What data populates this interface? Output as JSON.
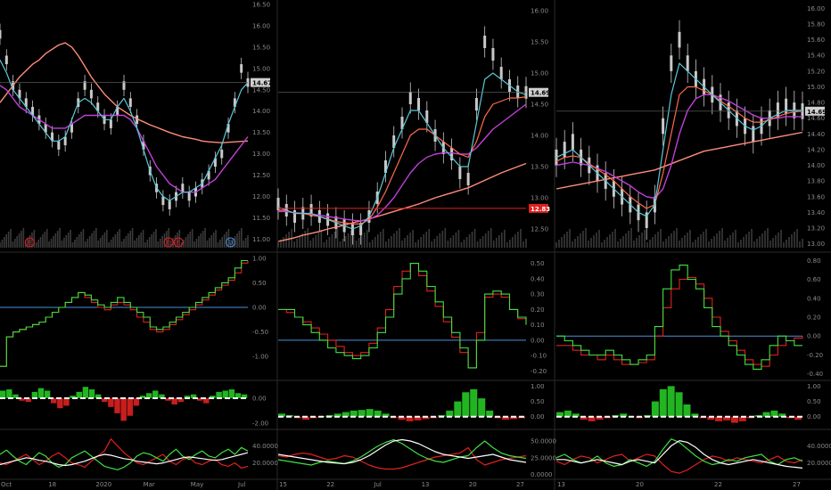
{
  "colors": {
    "background": "#000000",
    "divider": "#2a2a2a",
    "axis_text": "#8a8a8a",
    "candle": "#c8c8c8",
    "volume": "#3a3a3a",
    "ma_cyan": "#5bc8d8",
    "ma_orange": "#ff6b4a",
    "ma_magenta": "#c040d8",
    "ma_salmon": "#ff8c78",
    "line_red": "#e02020",
    "line_green": "#40e040",
    "line_blue": "#4a90d9",
    "line_white": "#ffffff",
    "hist_green": "#22b522",
    "hist_red": "#c81e1e",
    "price_label_bg": "#d0d0d0",
    "price_label_red": "#e02020"
  },
  "chart_data": [
    {
      "type": "line",
      "panel": "left-price",
      "timeframe_ticks": [
        "Oct",
        "18",
        "2020",
        "Mar",
        "May",
        "Jul"
      ],
      "y_ticks": [
        "16.50",
        "16.00",
        "15.50",
        "15.00",
        "14.50",
        "14.00",
        "13.50",
        "13.00",
        "12.50",
        "12.00",
        "11.50",
        "11.00"
      ],
      "ylim": [
        10.8,
        16.5
      ],
      "last_price_label": "14.67",
      "last_price": 14.67,
      "event_markers": [
        "E",
        "E",
        "E",
        "D"
      ],
      "price": [
        15.8,
        15.2,
        14.6,
        14.4,
        14.2,
        14.0,
        13.8,
        13.6,
        13.4,
        13.2,
        13.3,
        13.6,
        14.2,
        14.6,
        14.4,
        14.1,
        13.8,
        13.7,
        14.0,
        14.6,
        14.2,
        13.8,
        13.2,
        12.6,
        12.2,
        11.9,
        11.8,
        12.0,
        12.2,
        12.0,
        12.1,
        12.3,
        12.5,
        12.8,
        13.0,
        13.6,
        14.2,
        15.0,
        14.67
      ],
      "ma_cyan": [
        15.2,
        14.9,
        14.5,
        14.3,
        14.1,
        13.9,
        13.7,
        13.5,
        13.3,
        13.3,
        13.4,
        13.8,
        14.2,
        14.3,
        14.2,
        14.0,
        13.8,
        13.8,
        14.1,
        14.3,
        14.0,
        13.6,
        13.1,
        12.6,
        12.2,
        12.0,
        11.9,
        12.0,
        12.1,
        12.1,
        12.2,
        12.3,
        12.6,
        12.9,
        13.2,
        13.7,
        14.1,
        14.5,
        14.67
      ],
      "ma_magenta": [
        14.6,
        14.5,
        14.3,
        14.1,
        14.0,
        13.9,
        13.8,
        13.7,
        13.6,
        13.6,
        13.6,
        13.7,
        13.8,
        13.9,
        13.9,
        13.9,
        13.9,
        13.9,
        13.9,
        13.9,
        13.8,
        13.6,
        13.3,
        13.0,
        12.7,
        12.5,
        12.3,
        12.2,
        12.1,
        12.1,
        12.1,
        12.2,
        12.3,
        12.4,
        12.6,
        12.8,
        13.0,
        13.2,
        13.4
      ],
      "ma_salmon": [
        14.2,
        14.4,
        14.6,
        14.8,
        14.95,
        15.1,
        15.2,
        15.35,
        15.45,
        15.55,
        15.6,
        15.5,
        15.3,
        15.05,
        14.8,
        14.6,
        14.4,
        14.25,
        14.1,
        14.0,
        13.9,
        13.82,
        13.75,
        13.68,
        13.62,
        13.56,
        13.5,
        13.45,
        13.4,
        13.37,
        13.34,
        13.3,
        13.28,
        13.27,
        13.26,
        13.27,
        13.28,
        13.29,
        13.3
      ]
    },
    {
      "type": "line",
      "panel": "middle-price",
      "timeframe_ticks": [
        "15",
        "22",
        "Jul",
        "13",
        "20",
        "27"
      ],
      "y_ticks": [
        "16.00",
        "15.50",
        "15.00",
        "14.50",
        "14.00",
        "13.50",
        "13.00",
        "12.50"
      ],
      "ylim": [
        12.2,
        16.1
      ],
      "last_price_label": "14.69",
      "last_price": 14.69,
      "level_label": "12.83",
      "level": 12.83,
      "price": [
        12.9,
        12.8,
        12.7,
        12.75,
        12.8,
        12.7,
        12.65,
        12.6,
        12.55,
        12.5,
        12.5,
        12.7,
        13.0,
        13.5,
        13.9,
        14.2,
        14.6,
        14.5,
        14.3,
        14.0,
        13.8,
        13.7,
        13.4,
        13.3,
        14.5,
        15.5,
        15.3,
        15.0,
        14.8,
        14.7,
        14.69
      ],
      "ma_cyan": [
        12.85,
        12.8,
        12.75,
        12.75,
        12.75,
        12.7,
        12.65,
        12.6,
        12.55,
        12.5,
        12.55,
        12.7,
        13.0,
        13.4,
        13.8,
        14.1,
        14.4,
        14.4,
        14.2,
        14.0,
        13.8,
        13.65,
        13.5,
        13.5,
        14.2,
        14.9,
        15.0,
        14.9,
        14.8,
        14.7,
        14.65
      ],
      "ma_orange": [
        12.8,
        12.8,
        12.75,
        12.75,
        12.72,
        12.7,
        12.66,
        12.62,
        12.6,
        12.58,
        12.58,
        12.65,
        12.85,
        13.1,
        13.4,
        13.7,
        14.0,
        14.1,
        14.1,
        14.0,
        13.9,
        13.8,
        13.7,
        13.65,
        13.9,
        14.3,
        14.5,
        14.55,
        14.6,
        14.6,
        14.62
      ],
      "ma_magenta": [
        12.78,
        12.78,
        12.76,
        12.75,
        12.74,
        12.72,
        12.7,
        12.68,
        12.66,
        12.64,
        12.63,
        12.65,
        12.72,
        12.85,
        13.0,
        13.2,
        13.4,
        13.55,
        13.65,
        13.7,
        13.72,
        13.72,
        13.7,
        13.7,
        13.8,
        13.95,
        14.1,
        14.2,
        14.3,
        14.4,
        14.5
      ],
      "ma_salmon": [
        12.3,
        12.33,
        12.36,
        12.4,
        12.43,
        12.46,
        12.5,
        12.53,
        12.56,
        12.6,
        12.63,
        12.66,
        12.7,
        12.74,
        12.78,
        12.82,
        12.86,
        12.9,
        12.95,
        13.0,
        13.04,
        13.08,
        13.12,
        13.16,
        13.22,
        13.28,
        13.34,
        13.4,
        13.45,
        13.5,
        13.55
      ]
    },
    {
      "type": "line",
      "panel": "right-price",
      "timeframe_ticks": [
        "13",
        "20",
        "22",
        "27"
      ],
      "y_ticks": [
        "16.00",
        "15.80",
        "15.60",
        "15.40",
        "15.20",
        "15.00",
        "14.80",
        "14.60",
        "14.40",
        "14.20",
        "14.00",
        "13.80",
        "13.60",
        "13.40",
        "13.20",
        "13.00"
      ],
      "ylim": [
        12.95,
        16.05
      ],
      "last_price_label": "14.69",
      "last_price": 14.69,
      "price": [
        14.1,
        14.2,
        14.3,
        14.1,
        14.0,
        13.9,
        13.8,
        13.7,
        13.6,
        13.5,
        13.4,
        13.3,
        13.5,
        14.5,
        15.3,
        15.6,
        15.3,
        15.1,
        15.0,
        14.9,
        14.8,
        14.7,
        14.6,
        14.5,
        14.4,
        14.5,
        14.6,
        14.7,
        14.75,
        14.7,
        14.69
      ],
      "ma_cyan": [
        14.1,
        14.15,
        14.2,
        14.1,
        14.0,
        13.9,
        13.8,
        13.7,
        13.6,
        13.5,
        13.4,
        13.35,
        13.5,
        14.2,
        14.9,
        15.3,
        15.2,
        15.1,
        15.0,
        14.9,
        14.8,
        14.7,
        14.6,
        14.5,
        14.45,
        14.5,
        14.6,
        14.65,
        14.7,
        14.7,
        14.7
      ],
      "ma_orange": [
        14.05,
        14.1,
        14.12,
        14.1,
        14.02,
        13.95,
        13.88,
        13.8,
        13.7,
        13.6,
        13.52,
        13.45,
        13.5,
        13.9,
        14.4,
        14.9,
        15.0,
        15.0,
        14.95,
        14.9,
        14.82,
        14.75,
        14.68,
        14.6,
        14.55,
        14.55,
        14.58,
        14.62,
        14.66,
        14.68,
        14.69
      ],
      "ma_magenta": [
        14.0,
        14.02,
        14.04,
        14.02,
        14.0,
        13.96,
        13.92,
        13.86,
        13.8,
        13.74,
        13.66,
        13.6,
        13.58,
        13.7,
        14.0,
        14.4,
        14.7,
        14.85,
        14.9,
        14.9,
        14.86,
        14.82,
        14.76,
        14.7,
        14.64,
        14.6,
        14.6,
        14.6,
        14.62,
        14.62,
        14.62
      ],
      "ma_salmon": [
        13.7,
        13.72,
        13.74,
        13.76,
        13.78,
        13.8,
        13.82,
        13.84,
        13.86,
        13.88,
        13.9,
        13.92,
        13.94,
        13.98,
        14.02,
        14.06,
        14.1,
        14.14,
        14.18,
        14.2,
        14.22,
        14.24,
        14.26,
        14.28,
        14.3,
        14.32,
        14.34,
        14.36,
        14.38,
        14.4,
        14.42
      ]
    },
    {
      "type": "line",
      "panel": "left-oscillator",
      "y_ticks": [
        "1.00",
        "0.50",
        "0.00",
        "-0.50",
        "-1.00"
      ],
      "ylim": [
        -1.45,
        1.05
      ],
      "baseline": 0.0,
      "series_a": [
        -1.2,
        -0.6,
        -0.5,
        -0.45,
        -0.4,
        -0.35,
        -0.3,
        -0.2,
        -0.1,
        0.0,
        0.1,
        0.2,
        0.3,
        0.25,
        0.15,
        0.05,
        0.0,
        0.1,
        0.2,
        0.1,
        0.0,
        -0.1,
        -0.2,
        -0.4,
        -0.45,
        -0.4,
        -0.3,
        -0.2,
        -0.1,
        0.0,
        0.1,
        0.2,
        0.3,
        0.4,
        0.5,
        0.6,
        0.8,
        0.95,
        0.95
      ],
      "series_b": [
        -1.2,
        -0.6,
        -0.5,
        -0.45,
        -0.4,
        -0.35,
        -0.3,
        -0.2,
        -0.1,
        0.0,
        0.1,
        0.2,
        0.3,
        0.2,
        0.1,
        0.0,
        -0.05,
        0.05,
        0.1,
        0.05,
        -0.05,
        -0.2,
        -0.3,
        -0.45,
        -0.5,
        -0.45,
        -0.35,
        -0.25,
        -0.15,
        -0.05,
        0.05,
        0.15,
        0.25,
        0.35,
        0.45,
        0.55,
        0.7,
        0.9,
        0.95
      ]
    },
    {
      "type": "line",
      "panel": "middle-oscillator",
      "y_ticks": [
        "0.50",
        "0.40",
        "0.30",
        "0.20",
        "0.10",
        "0.00",
        "-0.10",
        "-0.20"
      ],
      "ylim": [
        -0.25,
        0.55
      ],
      "baseline": 0.0,
      "series_a": [
        0.2,
        0.2,
        0.15,
        0.1,
        0.05,
        0.0,
        -0.05,
        -0.08,
        -0.1,
        -0.12,
        -0.1,
        -0.05,
        0.05,
        0.15,
        0.3,
        0.4,
        0.5,
        0.45,
        0.35,
        0.25,
        0.15,
        0.05,
        -0.05,
        -0.18,
        0.0,
        0.3,
        0.32,
        0.3,
        0.2,
        0.15,
        0.1
      ],
      "series_b": [
        0.2,
        0.18,
        0.15,
        0.12,
        0.08,
        0.04,
        0.0,
        -0.04,
        -0.08,
        -0.1,
        -0.08,
        -0.02,
        0.08,
        0.2,
        0.35,
        0.45,
        0.5,
        0.42,
        0.32,
        0.22,
        0.12,
        0.02,
        -0.08,
        -0.18,
        0.05,
        0.28,
        0.3,
        0.28,
        0.2,
        0.14,
        0.1
      ]
    },
    {
      "type": "line",
      "panel": "right-oscillator",
      "y_ticks": [
        "0.80",
        "0.60",
        "0.40",
        "0.20",
        "0.00",
        "-0.20",
        "-0.40"
      ],
      "ylim": [
        -0.45,
        0.85
      ],
      "baseline": 0.0,
      "series_a": [
        0.0,
        -0.05,
        -0.1,
        -0.15,
        -0.2,
        -0.2,
        -0.15,
        -0.2,
        -0.25,
        -0.3,
        -0.25,
        -0.2,
        0.1,
        0.5,
        0.7,
        0.75,
        0.6,
        0.5,
        0.3,
        0.1,
        0.0,
        -0.1,
        -0.2,
        -0.3,
        -0.35,
        -0.25,
        -0.1,
        0.0,
        -0.05,
        -0.1,
        -0.1
      ],
      "series_b": [
        -0.1,
        -0.1,
        -0.15,
        -0.2,
        -0.2,
        -0.25,
        -0.2,
        -0.25,
        -0.3,
        -0.3,
        -0.28,
        -0.25,
        0.0,
        0.3,
        0.5,
        0.6,
        0.62,
        0.55,
        0.4,
        0.2,
        0.05,
        -0.05,
        -0.15,
        -0.25,
        -0.3,
        -0.32,
        -0.2,
        -0.1,
        -0.05,
        -0.02,
        0.0
      ]
    },
    {
      "type": "bar",
      "panel": "left-histogram",
      "y_ticks": [
        "0.00",
        "-2.00"
      ],
      "ylim": [
        -2.2,
        1.2
      ],
      "values": [
        0.6,
        0.7,
        0.3,
        -0.2,
        -0.3,
        0.5,
        0.8,
        0.6,
        -0.4,
        -0.8,
        -0.6,
        0.2,
        0.5,
        0.9,
        0.7,
        0.3,
        -0.3,
        -0.7,
        -1.2,
        -1.8,
        -1.4,
        -0.6,
        0.2,
        0.4,
        0.6,
        0.3,
        -0.2,
        -0.5,
        -0.3,
        0.2,
        0.3,
        -0.2,
        -0.4,
        0.2,
        0.5,
        0.6,
        0.7,
        0.4,
        0.3
      ]
    },
    {
      "type": "bar",
      "panel": "middle-histogram",
      "y_ticks": [
        "1.00",
        "0.50",
        "0.00"
      ],
      "ylim": [
        -0.3,
        1.1
      ],
      "values": [
        0.1,
        0.05,
        -0.05,
        -0.1,
        -0.05,
        0.02,
        0.05,
        0.1,
        0.15,
        0.2,
        0.22,
        0.25,
        0.2,
        0.1,
        -0.05,
        -0.1,
        -0.15,
        -0.12,
        -0.08,
        -0.05,
        0.05,
        0.2,
        0.5,
        0.8,
        0.9,
        0.6,
        0.2,
        -0.05,
        -0.1,
        -0.08,
        -0.05
      ]
    },
    {
      "type": "bar",
      "panel": "right-histogram",
      "y_ticks": [
        "1.00",
        "0.50",
        "0.00"
      ],
      "ylim": [
        -0.3,
        1.1
      ],
      "values": [
        0.15,
        0.2,
        0.1,
        -0.1,
        -0.15,
        -0.1,
        -0.05,
        0.05,
        0.1,
        0.0,
        -0.05,
        0.05,
        0.5,
        0.9,
        1.0,
        0.8,
        0.4,
        0.1,
        -0.05,
        -0.1,
        -0.15,
        -0.12,
        -0.2,
        -0.15,
        -0.05,
        0.05,
        0.15,
        0.2,
        0.1,
        -0.05,
        -0.1
      ]
    },
    {
      "type": "line",
      "panel": "left-dmi",
      "y_ticks": [
        "40.0000",
        "20.0000"
      ],
      "ylim": [
        5,
        55
      ],
      "white": [
        18,
        20,
        22,
        24,
        26,
        25,
        23,
        22,
        20,
        18,
        17,
        18,
        20,
        22,
        25,
        28,
        30,
        29,
        27,
        25,
        24,
        22,
        21,
        20,
        19,
        20,
        22,
        24,
        26,
        27,
        26,
        25,
        24,
        23,
        24,
        26,
        28,
        30,
        32
      ],
      "green": [
        30,
        35,
        28,
        22,
        18,
        25,
        32,
        28,
        20,
        15,
        18,
        26,
        30,
        34,
        28,
        22,
        16,
        14,
        12,
        15,
        20,
        28,
        32,
        30,
        26,
        22,
        30,
        36,
        28,
        24,
        30,
        34,
        28,
        26,
        32,
        36,
        30,
        38,
        34
      ],
      "red": [
        20,
        18,
        22,
        26,
        30,
        24,
        18,
        22,
        28,
        32,
        26,
        20,
        18,
        15,
        22,
        28,
        34,
        48,
        40,
        32,
        26,
        20,
        18,
        22,
        26,
        30,
        22,
        18,
        24,
        26,
        20,
        18,
        22,
        24,
        18,
        16,
        20,
        14,
        16
      ]
    },
    {
      "type": "line",
      "panel": "middle-dmi",
      "y_ticks": [
        "50.0000",
        "25.0000",
        "0.0000"
      ],
      "ylim": [
        -2,
        62
      ],
      "white": [
        30,
        28,
        26,
        24,
        22,
        20,
        18,
        17,
        16,
        18,
        22,
        28,
        36,
        44,
        50,
        52,
        50,
        46,
        40,
        34,
        30,
        28,
        26,
        24,
        26,
        28,
        30,
        26,
        22,
        20,
        18
      ],
      "green": [
        22,
        20,
        18,
        16,
        14,
        18,
        20,
        18,
        16,
        20,
        26,
        34,
        42,
        48,
        52,
        46,
        38,
        30,
        24,
        20,
        18,
        22,
        26,
        28,
        40,
        50,
        40,
        32,
        28,
        26,
        24
      ],
      "red": [
        28,
        26,
        30,
        32,
        30,
        26,
        22,
        24,
        28,
        26,
        20,
        14,
        10,
        8,
        8,
        10,
        14,
        18,
        22,
        26,
        28,
        30,
        32,
        40,
        22,
        14,
        18,
        22,
        24,
        26,
        28
      ]
    },
    {
      "type": "line",
      "panel": "right-dmi",
      "y_ticks": [
        "40.0000",
        "20.0000"
      ],
      "ylim": [
        5,
        55
      ],
      "white": [
        24,
        24,
        22,
        20,
        22,
        24,
        22,
        20,
        18,
        22,
        24,
        22,
        20,
        30,
        40,
        46,
        44,
        38,
        30,
        24,
        20,
        18,
        20,
        22,
        24,
        22,
        20,
        18,
        16,
        15,
        14
      ],
      "green": [
        26,
        30,
        24,
        20,
        22,
        28,
        20,
        16,
        18,
        24,
        20,
        16,
        22,
        36,
        48,
        44,
        36,
        28,
        22,
        18,
        20,
        24,
        22,
        26,
        28,
        30,
        22,
        18,
        24,
        26,
        22
      ],
      "red": [
        22,
        18,
        24,
        28,
        26,
        20,
        24,
        28,
        30,
        22,
        26,
        30,
        28,
        18,
        10,
        8,
        12,
        18,
        24,
        28,
        26,
        22,
        26,
        24,
        22,
        20,
        24,
        28,
        22,
        20,
        24
      ]
    }
  ]
}
